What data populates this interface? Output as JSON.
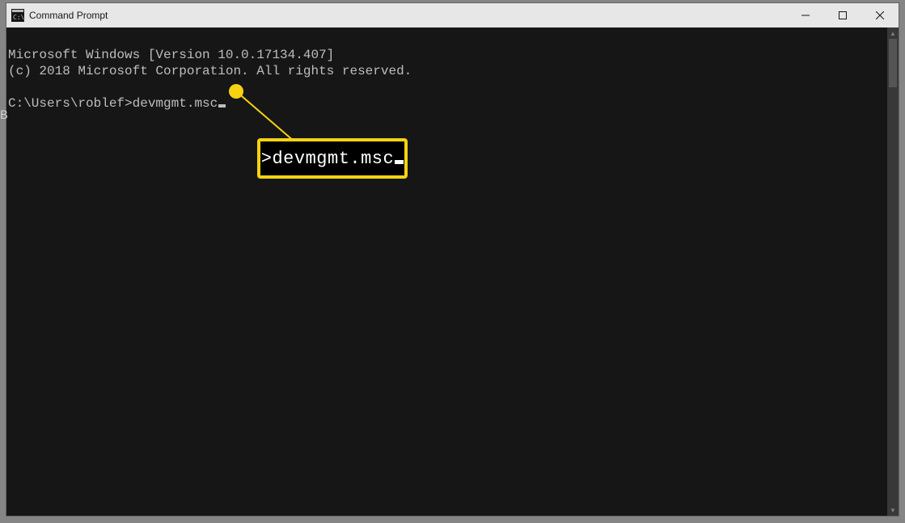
{
  "window": {
    "title": "Command Prompt"
  },
  "terminal": {
    "line1": "Microsoft Windows [Version 10.0.17134.407]",
    "line2": "(c) 2018 Microsoft Corporation. All rights reserved.",
    "prompt": "C:\\Users\\roblef>",
    "command": "devmgmt.msc"
  },
  "annotation": {
    "callout_prefix": ">",
    "callout_command": "devmgmt.msc"
  },
  "edge_char": "B"
}
